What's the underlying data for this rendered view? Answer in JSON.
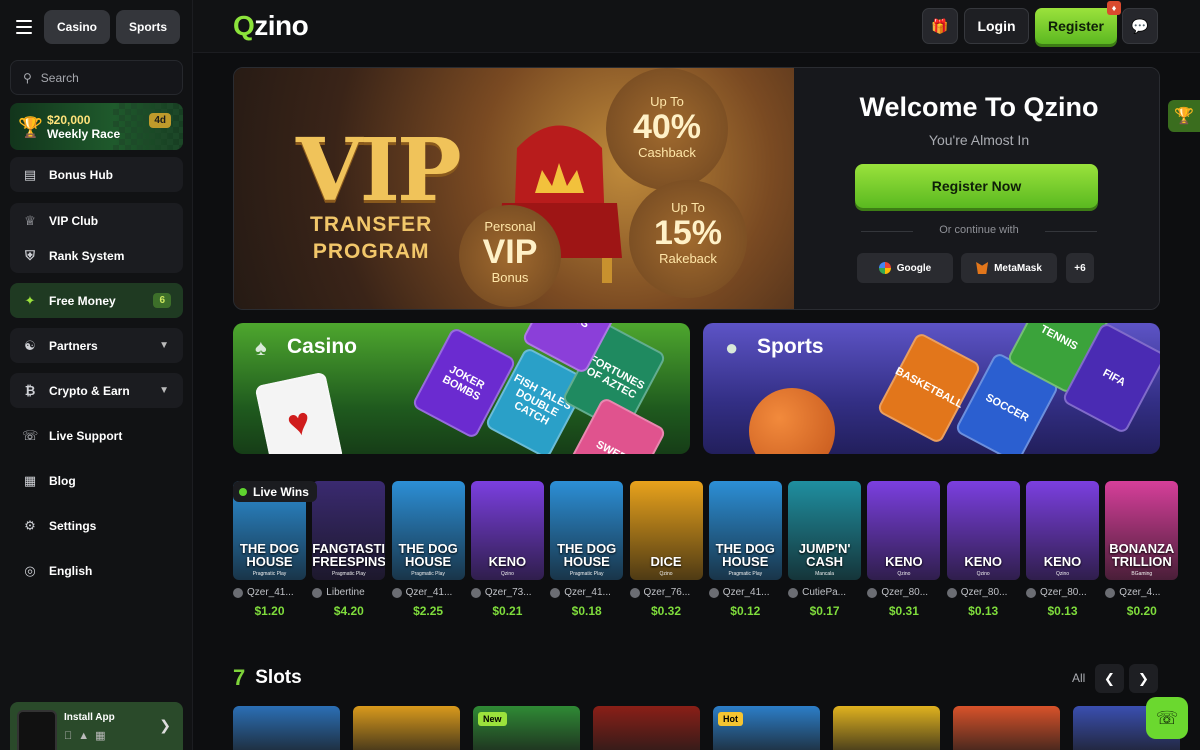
{
  "topnav": {
    "casino": "Casino",
    "sports": "Sports"
  },
  "search": {
    "placeholder": "Search"
  },
  "race": {
    "amount": "$20,000",
    "label": "Weekly Race",
    "badge": "4d"
  },
  "sidebar": {
    "bonus_hub": "Bonus Hub",
    "vip_club": "VIP Club",
    "rank_system": "Rank System",
    "free_money": "Free Money",
    "free_money_count": "6",
    "partners": "Partners",
    "crypto_earn": "Crypto & Earn",
    "live_support": "Live Support",
    "blog": "Blog",
    "settings": "Settings",
    "language": "English"
  },
  "install": {
    "label": "Install App"
  },
  "header": {
    "logo_q": "Q",
    "logo_rest": "zino",
    "login": "Login",
    "register": "Register"
  },
  "hero": {
    "vip_word": "VIP",
    "vip_sub_1": "TRANSFER",
    "vip_sub_2": "PROGRAM",
    "c40_top": "Up To",
    "c40_big": "40%",
    "c40_bottom": "Cashback",
    "c15_top": "Up To",
    "c15_big": "15%",
    "c15_bottom": "Rakeback",
    "cvip_top": "Personal",
    "cvip_big": "VIP",
    "cvip_bottom": "Bonus"
  },
  "welcome": {
    "title": "Welcome To Qzino",
    "subtitle": "You're Almost In",
    "register_now": "Register Now",
    "or_continue": "Or continue with",
    "google": "Google",
    "metamask": "MetaMask",
    "more": "+6"
  },
  "categories": {
    "casino": "Casino",
    "sports": "Sports"
  },
  "casino_tiles": [
    "JOKER BOMBS",
    "FISH TALES DOUBLE CATCH",
    "FORTUNES OF AZTEC",
    "SWEET",
    "WAYS"
  ],
  "sports_tiles": [
    "BASKETBALL",
    "SOCCER",
    "TENNIS",
    "FIFA"
  ],
  "live_wins": {
    "label": "Live Wins",
    "games": [
      {
        "title": "THE DOG HOUSE",
        "provider": "Pragmatic Play",
        "user": "Qzer_41...",
        "amount": "$1.20",
        "color": "#2c8fd6"
      },
      {
        "title": "FANGTASTIC FREESPINS",
        "provider": "Pragmatic Play",
        "user": "Libertine",
        "amount": "$4.20",
        "color": "#3a2a70"
      },
      {
        "title": "THE DOG HOUSE",
        "provider": "Pragmatic Play",
        "user": "Qzer_41...",
        "amount": "$2.25",
        "color": "#2c8fd6"
      },
      {
        "title": "KENO",
        "provider": "Qzino",
        "user": "Qzer_73...",
        "amount": "$0.21",
        "color": "#7b3fe0"
      },
      {
        "title": "THE DOG HOUSE",
        "provider": "Pragmatic Play",
        "user": "Qzer_41...",
        "amount": "$0.18",
        "color": "#2c8fd6"
      },
      {
        "title": "DICE",
        "provider": "Qzino",
        "user": "Qzer_76...",
        "amount": "$0.32",
        "color": "#e8a21c"
      },
      {
        "title": "THE DOG HOUSE",
        "provider": "Pragmatic Play",
        "user": "Qzer_41...",
        "amount": "$0.12",
        "color": "#2c8fd6"
      },
      {
        "title": "JUMP'N' CASH",
        "provider": "Mancala",
        "user": "CutiePa...",
        "amount": "$0.17",
        "color": "#1f8fa0"
      },
      {
        "title": "KENO",
        "provider": "Qzino",
        "user": "Qzer_80...",
        "amount": "$0.31",
        "color": "#7b3fe0"
      },
      {
        "title": "KENO",
        "provider": "Qzino",
        "user": "Qzer_80...",
        "amount": "$0.13",
        "color": "#7b3fe0"
      },
      {
        "title": "KENO",
        "provider": "Qzino",
        "user": "Qzer_80...",
        "amount": "$0.13",
        "color": "#7b3fe0"
      },
      {
        "title": "BONANZA TRILLION",
        "provider": "BGaming",
        "user": "Qzer_4...",
        "amount": "$0.20",
        "color": "#d63f9a"
      }
    ]
  },
  "slots": {
    "title": "Slots",
    "all": "All",
    "tiles": [
      {
        "tag": "",
        "color": "#2b6fb5"
      },
      {
        "tag": "",
        "color": "#d99a1c"
      },
      {
        "tag": "New",
        "color": "#2f8a35"
      },
      {
        "tag": "",
        "color": "#8a1f17"
      },
      {
        "tag": "Hot",
        "color": "#2c7ec8"
      },
      {
        "tag": "",
        "color": "#e0b21f"
      },
      {
        "tag": "",
        "color": "#d8522a"
      },
      {
        "tag": "",
        "color": "#3a4fb0"
      }
    ]
  },
  "colors": {
    "accent": "#8ce33b",
    "bg": "#0d0e10",
    "win": "#7fdc3c"
  }
}
